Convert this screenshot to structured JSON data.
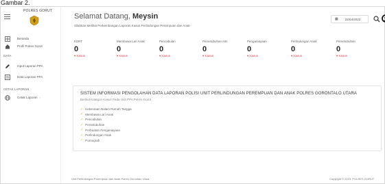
{
  "caption": "Gambar 2.",
  "sidebar": {
    "brand": "POLRES GORUT",
    "items": [
      {
        "label": "Beranda",
        "icon": "grid-icon"
      },
      {
        "label": "Profil Polres Gorut",
        "icon": "home-icon"
      }
    ],
    "section_data": "DATA",
    "items_data": [
      {
        "label": "Input Laporan PPA",
        "icon": "pencil-icon"
      },
      {
        "label": "Data Laporan PPA",
        "icon": "list-icon"
      }
    ],
    "section_form": "CETAK LAPORAN",
    "items_form": [
      {
        "label": "Cetak Laporan",
        "icon": "globe-icon"
      }
    ]
  },
  "header": {
    "greeting": "Selamat Datang, ",
    "username": "Meysin",
    "subtitle": "Silahkan Melihat Perkembangan Laporan Kasus Perlindungan Perempuan dan Anak",
    "date": "22/04/2023"
  },
  "stats": [
    {
      "label": "KDRT",
      "value": "0",
      "trend": "▾ Kasus"
    },
    {
      "label": "Membawa Lari Anak",
      "value": "0",
      "trend": "▾ Kasus"
    },
    {
      "label": "Pencabulan",
      "value": "0",
      "trend": "▾ Kasus"
    },
    {
      "label": "Persetubuhan Istri",
      "value": "0",
      "trend": "▾ Kasus"
    },
    {
      "label": "Penganiayaan",
      "value": "0",
      "trend": "▾ Kasus"
    },
    {
      "label": "Perlindungan Anak",
      "value": "0",
      "trend": "▾ Kasus"
    },
    {
      "label": "Persetubuhan",
      "value": "0",
      "trend": "▾ Kasus"
    }
  ],
  "card": {
    "title": "SISTEM INFORMASI PENGOLAHAN DATA LAPORAN POLISI UNIT PERLINDUNGAN PEREMPUAN DAN ANAK POLRES GORONTALO UTARA",
    "subtitle": "Berikut Kategori Kasus Pada Unit PPA Polres Gorut",
    "items": [
      "Kekerasan Dalam Rumah Tangga",
      "Membawa Lari Anak",
      "Pencabulan",
      "Persetubuhan",
      "Perbuatan Penganiayaan",
      "Perlindungan Anak",
      "Pornografi"
    ]
  },
  "footer": {
    "left": "Unit Perlindungan Perempuan dan Anak Polres Gorontalo Utara",
    "right": "Copyright © 2023. POLRES GORUT"
  },
  "colors": {
    "accent_red": "#e04050",
    "check_gold": "#d8b020",
    "logo_gold": "#d4a017"
  }
}
